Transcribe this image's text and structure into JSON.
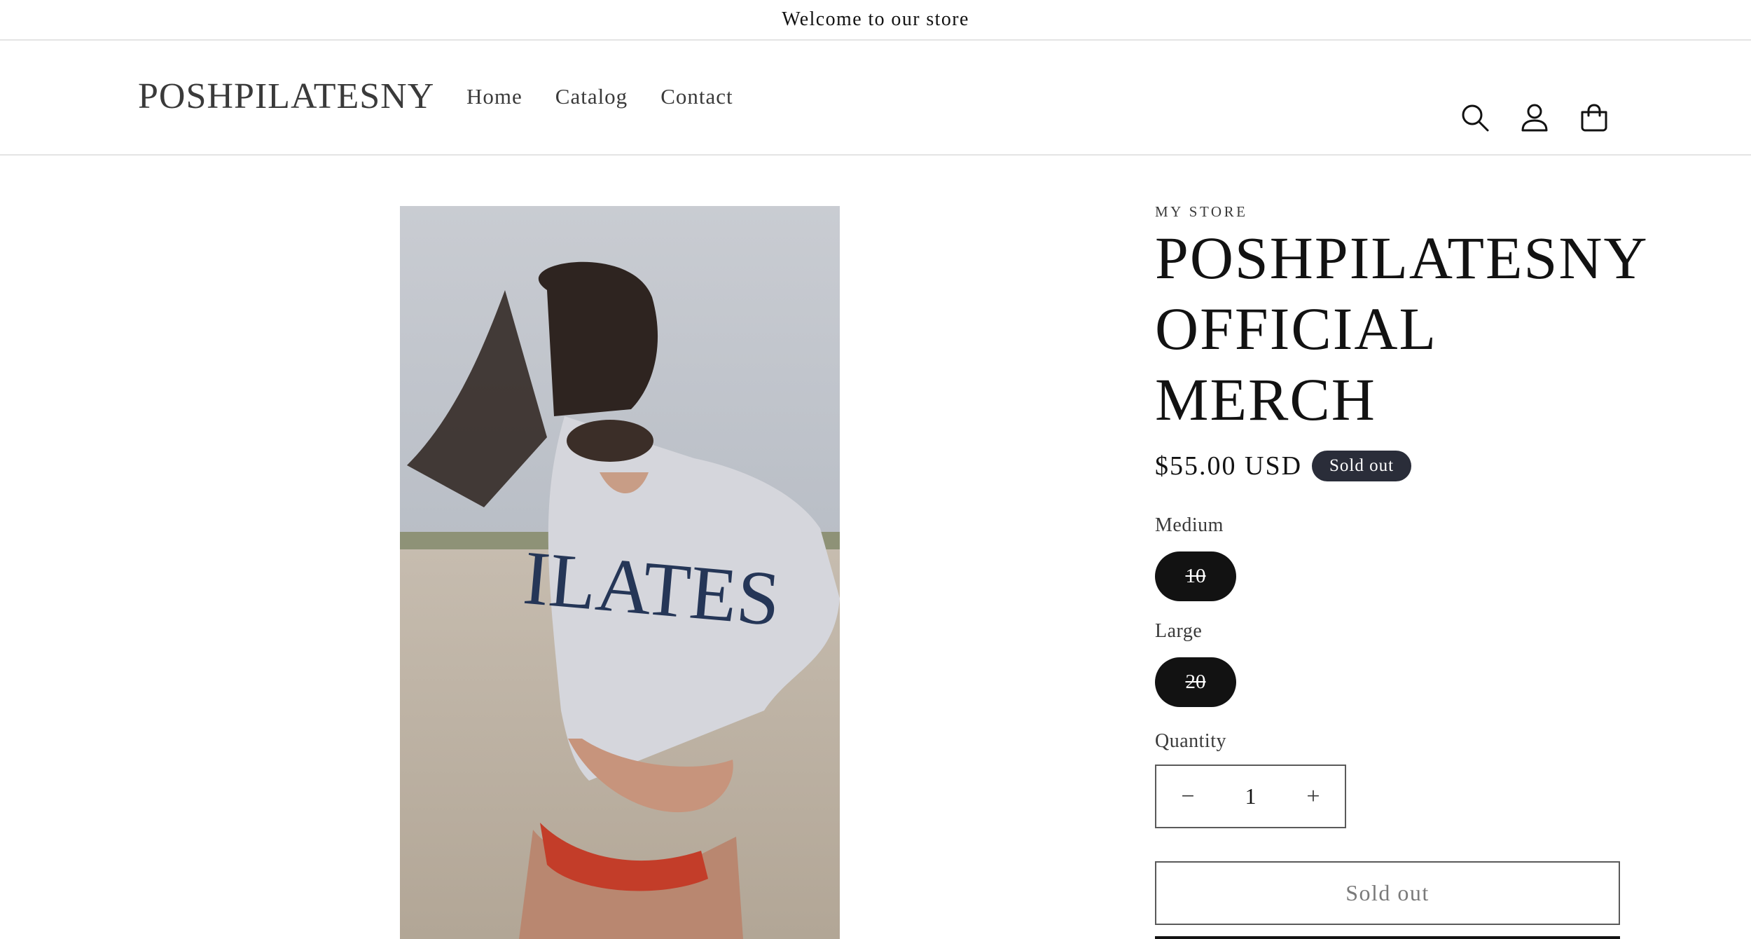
{
  "announcement": {
    "text": "Welcome to our store"
  },
  "header": {
    "logo": "POSHPILATESNY",
    "nav": [
      "Home",
      "Catalog",
      "Contact"
    ],
    "icons": [
      "search-icon",
      "account-icon",
      "cart-icon"
    ]
  },
  "product": {
    "vendor": "MY STORE",
    "title": "POSHPILATESNY OFFICIAL MERCH",
    "price": "$55.00 USD",
    "badge": "Sold out",
    "options": [
      {
        "label": "Medium",
        "value": "10",
        "available": false
      },
      {
        "label": "Large",
        "value": "20",
        "available": false
      }
    ],
    "quantity": {
      "label": "Quantity",
      "value": "1",
      "decrease": "−",
      "increase": "+"
    },
    "button": "Sold out"
  },
  "colors": {
    "badge": "#2a2d39",
    "pill": "#121212",
    "text": "#121212",
    "muted": "#7a7a7a"
  }
}
